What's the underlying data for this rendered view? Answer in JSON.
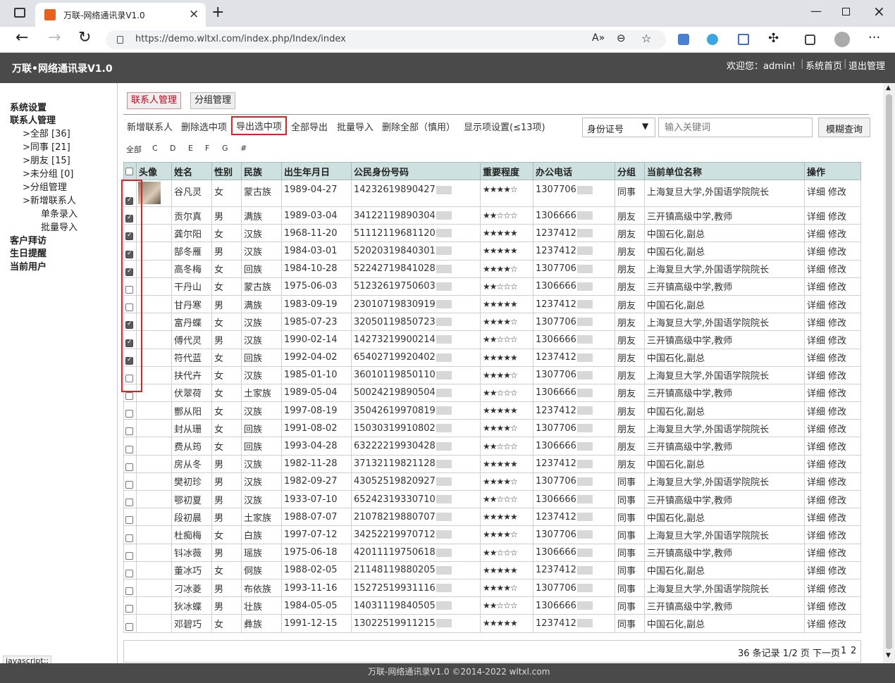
{
  "browser": {
    "tab_title": "万联-网络通讯录V1.0",
    "url": "https://demo.wltxl.com/index.php/Index/index"
  },
  "header": {
    "site_title": "万联•网络通讯录V1.0",
    "welcome": "欢迎您：admin!",
    "home_link": "系统首页",
    "logout_link": "退出管理"
  },
  "sidebar": {
    "system_settings": "系统设置",
    "contact_mgmt": "联系人管理",
    "groups": [
      {
        "label": ">全部 [36]"
      },
      {
        "label": ">同事 [21]"
      },
      {
        "label": ">朋友 [15]"
      },
      {
        "label": ">未分组 [0]"
      },
      {
        "label": ">分组管理"
      },
      {
        "label": ">新增联系人"
      }
    ],
    "single_entry": "单条录入",
    "batch_import": "批量导入",
    "customer_visit": "客户拜访",
    "birthday_reminder": "生日提醒",
    "current_user": "当前用户"
  },
  "tabs": {
    "contacts": "联系人管理",
    "groups": "分组管理"
  },
  "toolbar": {
    "new_contact": "新增联系人",
    "delete_selected": "删除选中项",
    "export_selected": "导出选中项",
    "export_all": "全部导出",
    "batch_import": "批量导入",
    "delete_all": "删除全部（慎用）",
    "display_settings": "显示项设置(≤13项)",
    "search_field": "身份证号",
    "search_placeholder": "输入关键词",
    "search_button": "模糊查询"
  },
  "letters": [
    "全部",
    "C",
    "D",
    "E",
    "F",
    "G",
    "#"
  ],
  "columns": [
    "头像",
    "姓名",
    "性别",
    "民族",
    "出生年月日",
    "公民身份号码",
    "重要程度",
    "办公电话",
    "分组",
    "当前单位名称",
    "操作"
  ],
  "ops": {
    "detail": "详细",
    "edit": "修改"
  },
  "rows": [
    {
      "checked": true,
      "name": "谷凡灵",
      "gender": "女",
      "ethnic": "蒙古族",
      "dob": "1989-04-27",
      "id": "14232619890427",
      "stars": "★★★★☆",
      "phone": "1307706",
      "group": "同事",
      "unit": "上海复旦大学,外国语学院院长",
      "avatar": true
    },
    {
      "checked": true,
      "name": "贡尔真",
      "gender": "男",
      "ethnic": "满族",
      "dob": "1989-03-04",
      "id": "34122119890304",
      "stars": "★★☆☆☆",
      "phone": "1306666",
      "group": "朋友",
      "unit": "三开镇高级中学,教师"
    },
    {
      "checked": true,
      "name": "龚尔阳",
      "gender": "女",
      "ethnic": "汉族",
      "dob": "1968-11-20",
      "id": "51112119681120",
      "stars": "★★★★★",
      "phone": "1237412",
      "group": "朋友",
      "unit": "中国石化,副总"
    },
    {
      "checked": true,
      "name": "郜冬雁",
      "gender": "男",
      "ethnic": "汉族",
      "dob": "1984-03-01",
      "id": "52020319840301",
      "stars": "★★★★★",
      "phone": "1237412",
      "group": "朋友",
      "unit": "中国石化,副总"
    },
    {
      "checked": true,
      "name": "高冬梅",
      "gender": "女",
      "ethnic": "回族",
      "dob": "1984-10-28",
      "id": "52242719841028",
      "stars": "★★★★☆",
      "phone": "1307706",
      "group": "朋友",
      "unit": "上海复旦大学,外国语学院院长"
    },
    {
      "checked": false,
      "name": "干丹山",
      "gender": "女",
      "ethnic": "蒙古族",
      "dob": "1975-06-03",
      "id": "51232619750603",
      "stars": "★★☆☆☆",
      "phone": "1306666",
      "group": "朋友",
      "unit": "三开镇高级中学,教师"
    },
    {
      "checked": false,
      "name": "甘丹寒",
      "gender": "男",
      "ethnic": "满族",
      "dob": "1983-09-19",
      "id": "23010719830919",
      "stars": "★★★★★",
      "phone": "1237412",
      "group": "朋友",
      "unit": "中国石化,副总"
    },
    {
      "checked": true,
      "name": "富丹蝶",
      "gender": "女",
      "ethnic": "汉族",
      "dob": "1985-07-23",
      "id": "32050119850723",
      "stars": "★★★★☆",
      "phone": "1307706",
      "group": "朋友",
      "unit": "上海复旦大学,外国语学院院长"
    },
    {
      "checked": true,
      "name": "傅代灵",
      "gender": "男",
      "ethnic": "汉族",
      "dob": "1990-02-14",
      "id": "14273219900214",
      "stars": "★★☆☆☆",
      "phone": "1306666",
      "group": "朋友",
      "unit": "三开镇高级中学,教师"
    },
    {
      "checked": true,
      "name": "符代蓝",
      "gender": "女",
      "ethnic": "回族",
      "dob": "1992-04-02",
      "id": "65402719920402",
      "stars": "★★★★★",
      "phone": "1237412",
      "group": "朋友",
      "unit": "中国石化,副总"
    },
    {
      "checked": false,
      "name": "扶代卉",
      "gender": "女",
      "ethnic": "汉族",
      "dob": "1985-01-10",
      "id": "36010119850110",
      "stars": "★★★★☆",
      "phone": "1307706",
      "group": "朋友",
      "unit": "上海复旦大学,外国语学院院长"
    },
    {
      "checked": false,
      "name": "伏翠荷",
      "gender": "女",
      "ethnic": "土家族",
      "dob": "1989-05-04",
      "id": "50024219890504",
      "stars": "★★☆☆☆",
      "phone": "1306666",
      "group": "朋友",
      "unit": "三开镇高级中学,教师"
    },
    {
      "checked": false,
      "name": "酆从阳",
      "gender": "女",
      "ethnic": "汉族",
      "dob": "1997-08-19",
      "id": "35042619970819",
      "stars": "★★★★★",
      "phone": "1237412",
      "group": "朋友",
      "unit": "中国石化,副总"
    },
    {
      "checked": false,
      "name": "封从珊",
      "gender": "女",
      "ethnic": "回族",
      "dob": "1991-08-02",
      "id": "15030319910802",
      "stars": "★★★★☆",
      "phone": "1307706",
      "group": "朋友",
      "unit": "上海复旦大学,外国语学院院长"
    },
    {
      "checked": false,
      "name": "费从筠",
      "gender": "女",
      "ethnic": "回族",
      "dob": "1993-04-28",
      "id": "63222219930428",
      "stars": "★★☆☆☆",
      "phone": "1306666",
      "group": "朋友",
      "unit": "三开镇高级中学,教师"
    },
    {
      "checked": false,
      "name": "房从冬",
      "gender": "男",
      "ethnic": "汉族",
      "dob": "1982-11-28",
      "id": "37132119821128",
      "stars": "★★★★★",
      "phone": "1237412",
      "group": "朋友",
      "unit": "中国石化,副总"
    },
    {
      "checked": false,
      "name": "樊初珍",
      "gender": "男",
      "ethnic": "汉族",
      "dob": "1982-09-27",
      "id": "43052519820927",
      "stars": "★★★★☆",
      "phone": "1307706",
      "group": "同事",
      "unit": "上海复旦大学,外国语学院院长"
    },
    {
      "checked": false,
      "name": "鄂初夏",
      "gender": "男",
      "ethnic": "汉族",
      "dob": "1933-07-10",
      "id": "65242319330710",
      "stars": "★★☆☆☆",
      "phone": "1306666",
      "group": "同事",
      "unit": "三开镇高级中学,教师"
    },
    {
      "checked": false,
      "name": "段初晨",
      "gender": "男",
      "ethnic": "土家族",
      "dob": "1988-07-07",
      "id": "21078219880707",
      "stars": "★★★★★",
      "phone": "1237412",
      "group": "同事",
      "unit": "中国石化,副总"
    },
    {
      "checked": false,
      "name": "杜痴梅",
      "gender": "女",
      "ethnic": "白族",
      "dob": "1997-07-12",
      "id": "34252219970712",
      "stars": "★★★★☆",
      "phone": "1307706",
      "group": "同事",
      "unit": "上海复旦大学,外国语学院院长"
    },
    {
      "checked": false,
      "name": "钭冰薇",
      "gender": "男",
      "ethnic": "瑶族",
      "dob": "1975-06-18",
      "id": "42011119750618",
      "stars": "★★☆☆☆",
      "phone": "1306666",
      "group": "同事",
      "unit": "三开镇高级中学,教师"
    },
    {
      "checked": false,
      "name": "董冰巧",
      "gender": "女",
      "ethnic": "侗族",
      "dob": "1988-02-05",
      "id": "21148119880205",
      "stars": "★★★★★",
      "phone": "1237412",
      "group": "同事",
      "unit": "中国石化,副总"
    },
    {
      "checked": false,
      "name": "刁冰菱",
      "gender": "男",
      "ethnic": "布依族",
      "dob": "1993-11-16",
      "id": "15272519931116",
      "stars": "★★★★☆",
      "phone": "1307706",
      "group": "同事",
      "unit": "上海复旦大学,外国语学院院长"
    },
    {
      "checked": false,
      "name": "狄冰蝶",
      "gender": "男",
      "ethnic": "壮族",
      "dob": "1984-05-05",
      "id": "14031119840505",
      "stars": "★★☆☆☆",
      "phone": "1306666",
      "group": "同事",
      "unit": "三开镇高级中学,教师"
    },
    {
      "checked": false,
      "name": "邓碧巧",
      "gender": "女",
      "ethnic": "彝族",
      "dob": "1991-12-15",
      "id": "13022519911215",
      "stars": "★★★★★",
      "phone": "1237412",
      "group": "同事",
      "unit": "中国石化,副总"
    }
  ],
  "pagination": {
    "summary": "36 条记录 1/2 页 下一页",
    "p1": "1",
    "p2": "2"
  },
  "footer": {
    "text": "万联-网络通讯录V1.0 ©2014-2022 wltxl.com"
  },
  "status_url": "javascript:;",
  "colors": {
    "header_bg": "#4a4a4a",
    "table_head": "#cfe0e1",
    "highlight": "#e02020"
  }
}
